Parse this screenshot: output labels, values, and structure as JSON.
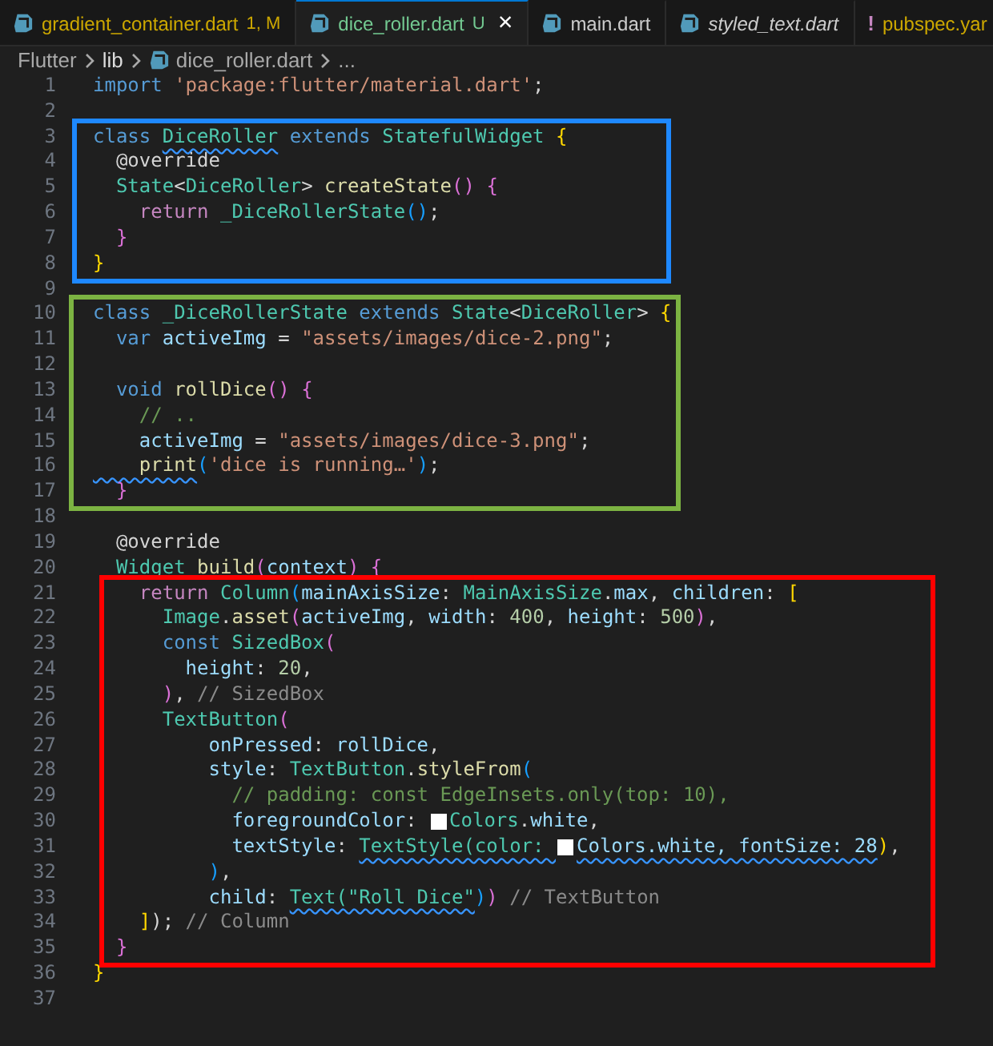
{
  "tabs": [
    {
      "label": "gradient_container.dart",
      "badge": "1, M",
      "color": "#cca700",
      "kind": "dart",
      "preview": false,
      "selected": false
    },
    {
      "label": "dice_roller.dart",
      "badge": "U",
      "color": "#73c991",
      "kind": "dart",
      "preview": false,
      "selected": true,
      "close": "×"
    },
    {
      "label": "main.dart",
      "color": "#cccccc",
      "kind": "dart",
      "preview": false,
      "selected": false
    },
    {
      "label": "styled_text.dart",
      "color": "#cccccc",
      "kind": "dart",
      "preview": true,
      "selected": false
    },
    {
      "label": "pubspec.yar",
      "color": "#cca700",
      "kind": "yaml",
      "glyph": "!",
      "preview": false,
      "selected": false
    }
  ],
  "breadcrumb": [
    {
      "label": "Flutter",
      "kind": "folder"
    },
    {
      "label": "lib",
      "kind": "folder"
    },
    {
      "label": "dice_roller.dart",
      "kind": "dart"
    },
    {
      "label": "...",
      "kind": "more"
    }
  ],
  "code": [
    {
      "lines": [
        {
          "n": "1",
          "t": [
            {
              "text": "import ",
              "kind": "k"
            },
            {
              "text": "'package:flutter/material.dart'",
              "kind": "s"
            },
            {
              "text": ";",
              "kind": "p"
            }
          ]
        },
        {
          "n": "2"
        }
      ]
    },
    {
      "color": "#1e88ff",
      "lines": [
        {
          "n": "3",
          "t": [
            {
              "text": "class ",
              "kind": "k"
            },
            {
              "text": "DiceRoller",
              "kind": "ty",
              "squiggle": true
            },
            {
              "text": " extends ",
              "kind": "k"
            },
            {
              "text": "StatefulWidget ",
              "kind": "ty"
            },
            {
              "text": "{",
              "kind": "b1"
            }
          ]
        },
        {
          "n": "4",
          "t": [
            {
              "text": "  @override",
              "kind": "p"
            }
          ]
        },
        {
          "n": "5",
          "t": [
            {
              "text": "  State",
              "kind": "ty"
            },
            {
              "text": "<",
              "kind": "p"
            },
            {
              "text": "DiceRoller",
              "kind": "ty"
            },
            {
              "text": "> ",
              "kind": "p"
            },
            {
              "text": "createState",
              "kind": "f"
            },
            {
              "text": "() ",
              "kind": "b2"
            },
            {
              "text": "{",
              "kind": "b2"
            }
          ]
        },
        {
          "n": "6",
          "t": [
            {
              "text": "    return ",
              "kind": "c"
            },
            {
              "text": "_DiceRollerState",
              "kind": "ty"
            },
            {
              "text": "()",
              "kind": "b3"
            },
            {
              "text": ";",
              "kind": "p"
            }
          ]
        },
        {
          "n": "7",
          "t": [
            {
              "text": "  }",
              "kind": "b2"
            }
          ]
        },
        {
          "n": "8",
          "t": [
            {
              "text": "}",
              "kind": "b1"
            }
          ]
        }
      ]
    },
    {
      "lines": [
        {
          "n": "9"
        }
      ]
    },
    {
      "color": "#7cb342",
      "lines": [
        {
          "n": "10",
          "t": [
            {
              "text": "class ",
              "kind": "k"
            },
            {
              "text": "_DiceRollerState",
              "kind": "ty"
            },
            {
              "text": " extends ",
              "kind": "k"
            },
            {
              "text": "State",
              "kind": "ty"
            },
            {
              "text": "<",
              "kind": "p"
            },
            {
              "text": "DiceRoller",
              "kind": "ty"
            },
            {
              "text": "> ",
              "kind": "p"
            },
            {
              "text": "{",
              "kind": "b1"
            }
          ]
        },
        {
          "n": "11",
          "t": [
            {
              "text": "  var ",
              "kind": "k"
            },
            {
              "text": "activeImg",
              "kind": "v"
            },
            {
              "text": " = ",
              "kind": "p"
            },
            {
              "text": "\"assets/images/dice-2.png\"",
              "kind": "s"
            },
            {
              "text": ";",
              "kind": "p"
            }
          ]
        },
        {
          "n": "12"
        },
        {
          "n": "13",
          "t": [
            {
              "text": "  void ",
              "kind": "k"
            },
            {
              "text": "rollDice",
              "kind": "f"
            },
            {
              "text": "() ",
              "kind": "b2"
            },
            {
              "text": "{",
              "kind": "b2"
            }
          ]
        },
        {
          "n": "14",
          "t": [
            {
              "text": "    // ..",
              "kind": "cm"
            }
          ]
        },
        {
          "n": "15",
          "t": [
            {
              "text": "    activeImg",
              "kind": "v"
            },
            {
              "text": " = ",
              "kind": "p"
            },
            {
              "text": "\"assets/images/dice-3.png\"",
              "kind": "s"
            },
            {
              "text": ";",
              "kind": "p"
            }
          ]
        },
        {
          "n": "16",
          "t": [
            {
              "text": "    print",
              "kind": "f",
              "squiggle": true
            },
            {
              "text": "(",
              "kind": "b3"
            },
            {
              "text": "'dice is running…'",
              "kind": "s"
            },
            {
              "text": ")",
              "kind": "b3"
            },
            {
              "text": ";",
              "kind": "p"
            }
          ]
        },
        {
          "n": "17",
          "t": [
            {
              "text": "  }",
              "kind": "b2"
            }
          ]
        }
      ]
    },
    {
      "lines": [
        {
          "n": "18"
        },
        {
          "n": "19",
          "t": [
            {
              "text": "  @override",
              "kind": "p"
            }
          ]
        },
        {
          "n": "20",
          "t": [
            {
              "text": "  Widget ",
              "kind": "ty"
            },
            {
              "text": "build",
              "kind": "f"
            },
            {
              "text": "(",
              "kind": "b2"
            },
            {
              "text": "context",
              "kind": "v"
            },
            {
              "text": ") ",
              "kind": "b2"
            },
            {
              "text": "{",
              "kind": "b2"
            }
          ]
        }
      ]
    },
    {
      "color": "#ff0000",
      "lines": [
        {
          "n": "21",
          "t": [
            {
              "text": "    return ",
              "kind": "c"
            },
            {
              "text": "Column",
              "kind": "ty"
            },
            {
              "text": "(",
              "kind": "b3"
            },
            {
              "text": "mainAxisSize",
              "kind": "v"
            },
            {
              "text": ": ",
              "kind": "p"
            },
            {
              "text": "MainAxisSize",
              "kind": "ty"
            },
            {
              "text": ".",
              "kind": "p"
            },
            {
              "text": "max",
              "kind": "v"
            },
            {
              "text": ", ",
              "kind": "p"
            },
            {
              "text": "children",
              "kind": "v"
            },
            {
              "text": ": ",
              "kind": "p"
            },
            {
              "text": "[",
              "kind": "b1"
            }
          ]
        },
        {
          "n": "22",
          "t": [
            {
              "text": "      Image",
              "kind": "ty"
            },
            {
              "text": ".",
              "kind": "p"
            },
            {
              "text": "asset",
              "kind": "f"
            },
            {
              "text": "(",
              "kind": "b2"
            },
            {
              "text": "activeImg",
              "kind": "v"
            },
            {
              "text": ", ",
              "kind": "p"
            },
            {
              "text": "width",
              "kind": "v"
            },
            {
              "text": ": ",
              "kind": "p"
            },
            {
              "text": "400",
              "kind": "num"
            },
            {
              "text": ", ",
              "kind": "p"
            },
            {
              "text": "height",
              "kind": "v"
            },
            {
              "text": ": ",
              "kind": "p"
            },
            {
              "text": "500",
              "kind": "num"
            },
            {
              "text": ")",
              "kind": "b2"
            },
            {
              "text": ",",
              "kind": "p"
            }
          ]
        },
        {
          "n": "23",
          "t": [
            {
              "text": "      const ",
              "kind": "k"
            },
            {
              "text": "SizedBox",
              "kind": "ty"
            },
            {
              "text": "(",
              "kind": "b2"
            }
          ]
        },
        {
          "n": "24",
          "t": [
            {
              "text": "        height",
              "kind": "v"
            },
            {
              "text": ": ",
              "kind": "p"
            },
            {
              "text": "20",
              "kind": "num"
            },
            {
              "text": ",",
              "kind": "p"
            }
          ]
        },
        {
          "n": "25",
          "t": [
            {
              "text": "      )",
              "kind": "b2"
            },
            {
              "text": ", ",
              "kind": "p"
            },
            {
              "text": "// SizedBox",
              "kind": "h"
            }
          ]
        },
        {
          "n": "26",
          "t": [
            {
              "text": "      TextButton",
              "kind": "ty"
            },
            {
              "text": "(",
              "kind": "b2"
            }
          ]
        },
        {
          "n": "27",
          "t": [
            {
              "text": "          onPressed",
              "kind": "v"
            },
            {
              "text": ": ",
              "kind": "p"
            },
            {
              "text": "rollDice",
              "kind": "v"
            },
            {
              "text": ",",
              "kind": "p"
            }
          ]
        },
        {
          "n": "28",
          "t": [
            {
              "text": "          style",
              "kind": "v"
            },
            {
              "text": ": ",
              "kind": "p"
            },
            {
              "text": "TextButton",
              "kind": "ty"
            },
            {
              "text": ".",
              "kind": "p"
            },
            {
              "text": "styleFrom",
              "kind": "f"
            },
            {
              "text": "(",
              "kind": "b3"
            }
          ]
        },
        {
          "n": "29",
          "t": [
            {
              "text": "            // padding: const EdgeInsets.only(top: 10),",
              "kind": "cm"
            }
          ]
        },
        {
          "n": "30",
          "t": [
            {
              "text": "            foregroundColor",
              "kind": "v"
            },
            {
              "text": ": ",
              "kind": "p"
            },
            {
              "kind": "swatch",
              "color": "#ffffff"
            },
            {
              "text": "Colors",
              "kind": "ty"
            },
            {
              "text": ".",
              "kind": "p"
            },
            {
              "text": "white",
              "kind": "v"
            },
            {
              "text": ",",
              "kind": "p"
            }
          ]
        },
        {
          "n": "31",
          "t": [
            {
              "text": "            textStyle",
              "kind": "v"
            },
            {
              "text": ": ",
              "kind": "p"
            },
            {
              "text": "TextStyle(color: ",
              "kind": "ty",
              "squiggle": true
            },
            {
              "kind": "swatch",
              "color": "#ffffff"
            },
            {
              "text": "Colors.white, fontSize: 28",
              "kind": "v",
              "squiggle": true
            },
            {
              "text": ")",
              "kind": "b1"
            },
            {
              "text": ",",
              "kind": "p"
            }
          ]
        },
        {
          "n": "32",
          "t": [
            {
              "text": "          )",
              "kind": "b3"
            },
            {
              "text": ",",
              "kind": "p"
            }
          ]
        },
        {
          "n": "33",
          "t": [
            {
              "text": "          child",
              "kind": "v"
            },
            {
              "text": ": ",
              "kind": "p"
            },
            {
              "text": "Text(\"Roll Dice\"",
              "kind": "ty",
              "squiggle": true
            },
            {
              "text": ")",
              "kind": "b3"
            },
            {
              "text": ")",
              "kind": "b2"
            },
            {
              "text": " // TextButton",
              "kind": "h"
            }
          ]
        },
        {
          "n": "34",
          "t": [
            {
              "text": "    ]",
              "kind": "b1"
            },
            {
              "text": ");",
              "kind": "p"
            },
            {
              "text": " // Column",
              "kind": "h"
            }
          ]
        },
        {
          "n": "35",
          "t": [
            {
              "text": "  }",
              "kind": "b2"
            }
          ]
        }
      ]
    },
    {
      "lines": [
        {
          "n": "36",
          "t": [
            {
              "text": "}",
              "kind": "b1"
            }
          ]
        },
        {
          "n": "37"
        }
      ]
    }
  ]
}
